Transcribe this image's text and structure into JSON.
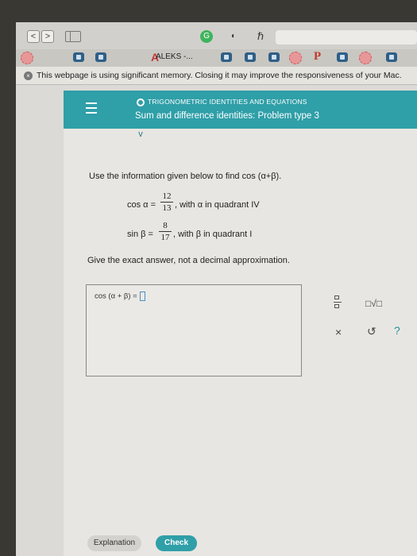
{
  "browser": {
    "back_glyph": "<",
    "forward_glyph": ">",
    "tab_title": "ALEKS -...",
    "tab_logo_letter": "A",
    "tab_p_letter": "P",
    "extension_r_glyph": "ℏ",
    "extension_d_glyph": "◐"
  },
  "notice": {
    "icon_glyph": "×",
    "text": "This webpage is using significant memory. Closing it may improve the responsiveness of your Mac."
  },
  "header": {
    "topic": "TRIGONOMETRIC IDENTITIES AND EQUATIONS",
    "problem_title": "Sum and difference identities: Problem type 3",
    "collapse_glyph": "v"
  },
  "problem": {
    "prompt": "Use the information given below to find cos (α+β).",
    "cos_lhs": "cos α =",
    "cos_numerator": "12",
    "cos_denominator": "13",
    "cos_rest": ", with α in quadrant IV",
    "sin_lhs": "sin β =",
    "sin_numerator": "8",
    "sin_denominator": "17",
    "sin_rest": ", with β in quadrant I",
    "instruction": "Give the exact answer, not a decimal approximation.",
    "answer_label": "cos (α + β) ="
  },
  "tools": {
    "sqrt_label": "□√□",
    "clear_glyph": "×",
    "undo_glyph": "↺",
    "help_glyph": "?"
  },
  "buttons": {
    "explanation": "Explanation",
    "check": "Check"
  },
  "colors": {
    "accent": "#2f9fa8",
    "brand_red": "#c23a3a"
  }
}
